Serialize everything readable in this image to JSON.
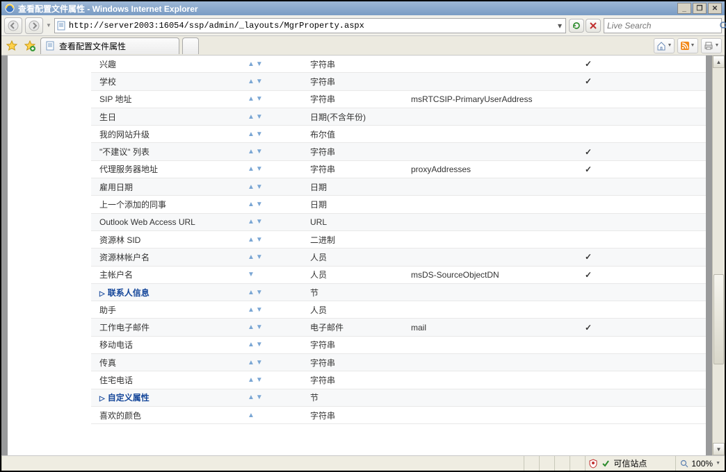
{
  "window_title": "查看配置文件属性 - Windows Internet Explorer",
  "url": "http://server2003:16054/ssp/admin/_layouts/MgrProperty.aspx",
  "search_placeholder": "Live Search",
  "tab_title": "查看配置文件属性",
  "status": {
    "zone": "可信站点",
    "zoom": "100%"
  },
  "rows": [
    {
      "name": "兴趣",
      "arrows": "both",
      "type": "字符串",
      "map": "",
      "ml": true,
      "alt": false
    },
    {
      "name": "学校",
      "arrows": "both",
      "type": "字符串",
      "map": "",
      "ml": true,
      "alt": true
    },
    {
      "name": "SIP 地址",
      "arrows": "both",
      "type": "字符串",
      "map": "msRTCSIP-PrimaryUserAddress",
      "ml": false,
      "alt": false
    },
    {
      "name": "生日",
      "arrows": "both",
      "type": "日期(不含年份)",
      "map": "",
      "ml": false,
      "alt": true
    },
    {
      "name": "我的网站升级",
      "arrows": "both",
      "type": "布尔值",
      "map": "",
      "ml": false,
      "alt": false
    },
    {
      "name": "\"不建议\" 列表",
      "arrows": "both",
      "type": "字符串",
      "map": "",
      "ml": true,
      "alt": true
    },
    {
      "name": "代理服务器地址",
      "arrows": "both",
      "type": "字符串",
      "map": "proxyAddresses",
      "ml": true,
      "alt": false
    },
    {
      "name": "雇用日期",
      "arrows": "both",
      "type": "日期",
      "map": "",
      "ml": false,
      "alt": true
    },
    {
      "name": "上一个添加的同事",
      "arrows": "both",
      "type": "日期",
      "map": "",
      "ml": false,
      "alt": false
    },
    {
      "name": "Outlook Web Access URL",
      "arrows": "both",
      "type": "URL",
      "map": "",
      "ml": false,
      "alt": true
    },
    {
      "name": "资源林 SID",
      "arrows": "both",
      "type": "二进制",
      "map": "",
      "ml": false,
      "alt": false
    },
    {
      "name": "资源林帐户名",
      "arrows": "both",
      "type": "人员",
      "map": "",
      "ml": true,
      "alt": true
    },
    {
      "name": "主帐户名",
      "arrows": "down",
      "type": "人员",
      "map": "msDS-SourceObjectDN",
      "ml": true,
      "alt": false
    },
    {
      "name": "联系人信息",
      "section": true,
      "arrows": "both",
      "type": "节",
      "map": "",
      "ml": false,
      "alt": true
    },
    {
      "name": "助手",
      "arrows": "both",
      "type": "人员",
      "map": "",
      "ml": false,
      "alt": false
    },
    {
      "name": "工作电子邮件",
      "arrows": "both",
      "type": "电子邮件",
      "map": "mail",
      "ml": true,
      "alt": true
    },
    {
      "name": "移动电话",
      "arrows": "both",
      "type": "字符串",
      "map": "",
      "ml": false,
      "alt": false
    },
    {
      "name": "传真",
      "arrows": "both",
      "type": "字符串",
      "map": "",
      "ml": false,
      "alt": true
    },
    {
      "name": "住宅电话",
      "arrows": "both",
      "type": "字符串",
      "map": "",
      "ml": false,
      "alt": false
    },
    {
      "name": "自定义属性",
      "section": true,
      "arrows": "both",
      "type": "节",
      "map": "",
      "ml": false,
      "alt": true
    },
    {
      "name": "喜欢的颜色",
      "arrows": "up",
      "type": "字符串",
      "map": "",
      "ml": false,
      "alt": false
    }
  ]
}
